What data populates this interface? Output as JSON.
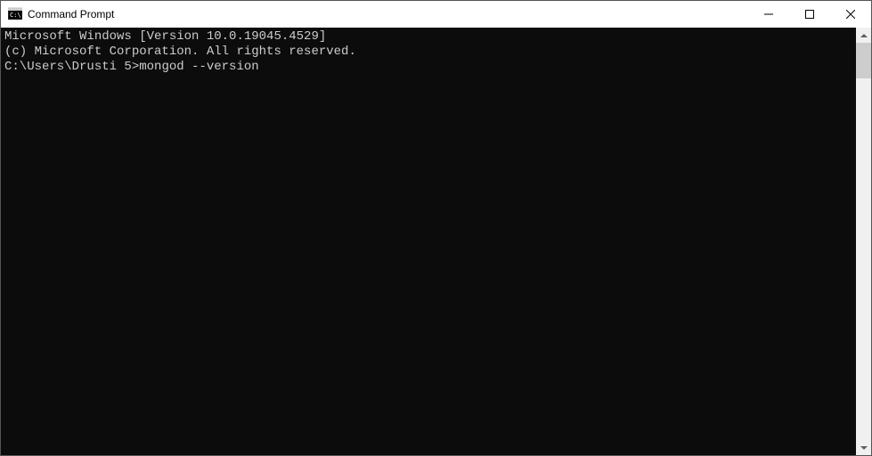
{
  "window": {
    "title": "Command Prompt"
  },
  "console": {
    "line1": "Microsoft Windows [Version 10.0.19045.4529]",
    "line2": "(c) Microsoft Corporation. All rights reserved.",
    "blank": "",
    "prompt": "C:\\Users\\Drusti 5>",
    "command": "mongod --version"
  }
}
